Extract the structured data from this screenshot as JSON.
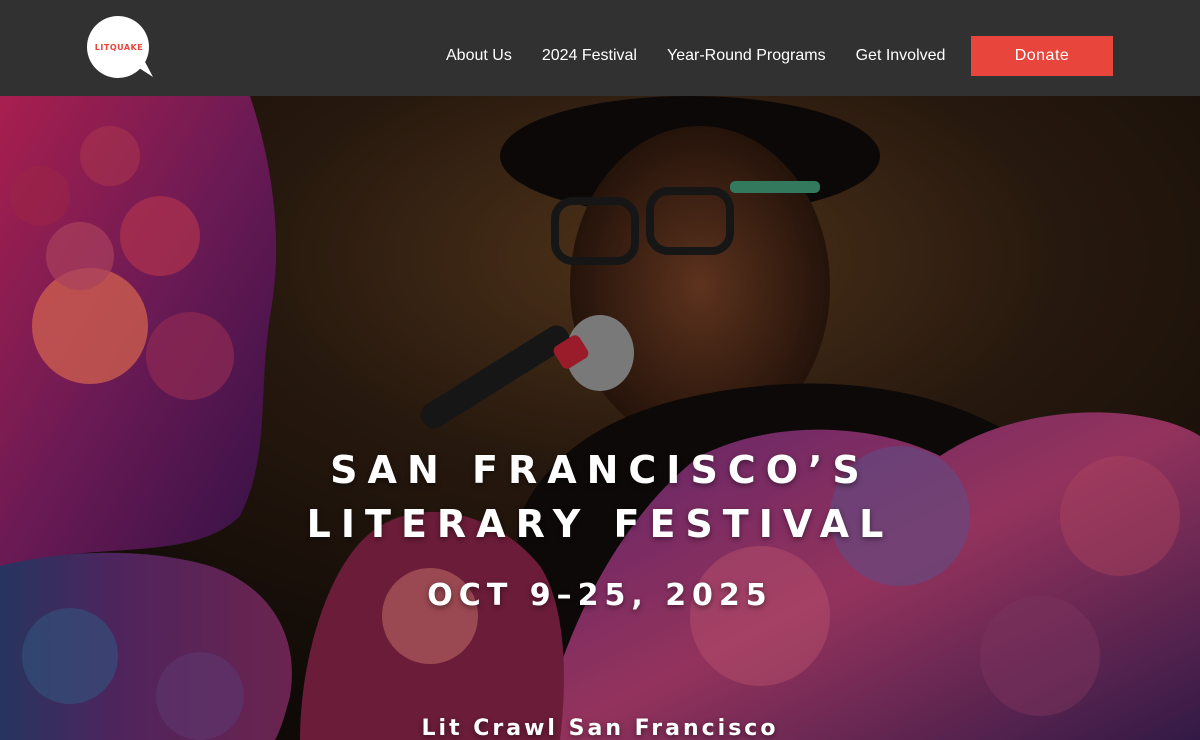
{
  "header": {
    "logo_text": "LITQUAKE",
    "nav": [
      {
        "label": "About Us"
      },
      {
        "label": "2024 Festival"
      },
      {
        "label": "Year-Round Programs"
      },
      {
        "label": "Get Involved"
      }
    ],
    "donate_label": "Donate"
  },
  "hero": {
    "title_line1": "SAN FRANCISCO’S",
    "title_line2": "LITERARY FESTIVAL",
    "dates": "OCT 9–25, 2025",
    "subtitle": "Lit Crawl San Francisco"
  },
  "colors": {
    "header_bg": "#313131",
    "accent": "#e8453c",
    "text": "#ffffff"
  },
  "icons": {
    "logo": "litquake-speech-bubble-logo"
  }
}
